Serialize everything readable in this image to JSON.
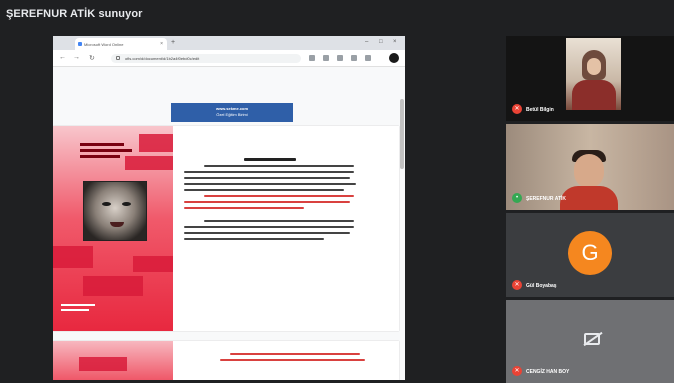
{
  "meet": {
    "presenter_banner": "ŞEREFNUR ATİK sunuyor"
  },
  "browser": {
    "tab_title": "Microsoft Word Online",
    "tab_close": "×",
    "new_tab": "+",
    "url": "ofis.com/d/document/d/1b2a4f0ebd0c/edit",
    "nav_back": "←",
    "nav_forward": "→",
    "nav_reload": "↻",
    "win_min": "–",
    "win_max": "□",
    "win_close": "×"
  },
  "document": {
    "header_line1": "www.sekme.com",
    "header_line2": "Özel Eğitim Birimi"
  },
  "participants": [
    {
      "name": "Betül Bilgin",
      "mic": "muted"
    },
    {
      "name": "ŞEREFNUR ATİK",
      "mic": "on"
    },
    {
      "name": "Gül Boyabaş",
      "mic": "muted",
      "avatar_letter": "G"
    },
    {
      "name": "CENGİZ HAN BOY",
      "mic": "muted"
    }
  ],
  "icons": {
    "mic_muted_glyph": "✕",
    "mic_on_glyph": "•"
  },
  "colors": {
    "meet_bg": "#1f2022",
    "doc_header_blue": "#2f5fa8",
    "stripe_red": "#e8283f",
    "avatar_orange": "#f5871f",
    "mic_muted": "#ea4335",
    "mic_on": "#34a853"
  }
}
